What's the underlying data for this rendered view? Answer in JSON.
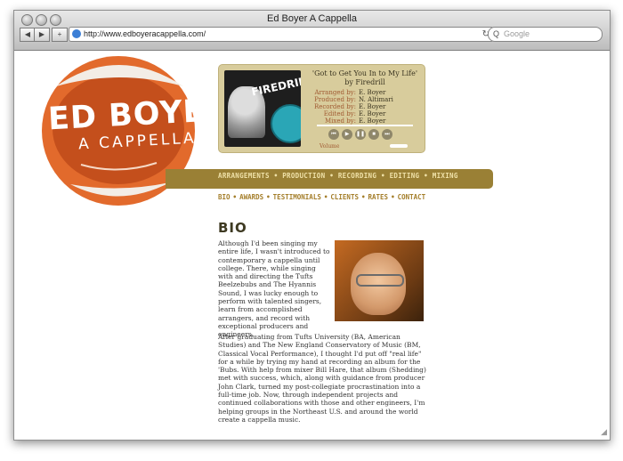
{
  "browser": {
    "window_title": "Ed Boyer A Cappella",
    "url": "http://www.edboyeracappella.com/",
    "search_placeholder": "Google",
    "back_glyph": "◀",
    "forward_glyph": "▶",
    "add_glyph": "+",
    "reload_glyph": "↻",
    "search_glyph": "Q"
  },
  "logo": {
    "line1": "ED BOYER",
    "line2": "A CAPPELLA"
  },
  "player": {
    "album_text": "FIREDRILL!",
    "song_title": "'Got to Get You In to My Life'",
    "song_by": "by Firedrill",
    "credits": [
      {
        "label": "Arranged by:",
        "value": "E. Boyer"
      },
      {
        "label": "Produced by:",
        "value": "N. Altimari"
      },
      {
        "label": "Recorded by:",
        "value": "E. Boyer"
      },
      {
        "label": "Edited by:",
        "value": "E. Boyer"
      },
      {
        "label": "Mixed by:",
        "value": "E. Boyer"
      }
    ],
    "controls": {
      "prev": "⏮",
      "play": "▶",
      "pause": "❚❚",
      "stop": "■",
      "next": "⏭"
    },
    "volume_label": "Volume"
  },
  "main_nav": {
    "text": "ARRANGEMENTS • PRODUCTION • RECORDING • EDITING • MIXING"
  },
  "sub_nav": {
    "items": [
      "BIO",
      "AWARDS",
      "TESTIMONIALS",
      "CLIENTS",
      "RATES",
      "CONTACT"
    ],
    "sep": "•"
  },
  "bio": {
    "heading": "BIO",
    "p1": "Although I'd been singing my entire life, I wasn't introduced to contemporary a cappella until college. There, while singing with and directing the Tufts Beelzebubs and The Hyannis Sound, I was lucky enough to perform with talented singers, learn from accomplished arrangers, and record with exceptional producers and engineers.",
    "p2": "After graduating from Tufts University (BA, American Studies) and The New England Conservatory of Music (BM, Classical Vocal Performance), I thought I'd put off \"real life\" for a while by trying my hand at recording an album for the 'Bubs. With help from mixer Bill Hare, that album (Shedding) met with success, which, along with guidance from producer John Clark, turned my post-collegiate procrastination into a full-time job. Now, through independent projects and continued collaborations with those and other engineers, I'm helping groups in the Northeast U.S. and around the world create a cappella music."
  },
  "colors": {
    "accent_gold": "#9a8035",
    "player_bg": "#d8cc9c",
    "lips_orange": "#e26a2c",
    "label_rust": "#a05a32"
  }
}
